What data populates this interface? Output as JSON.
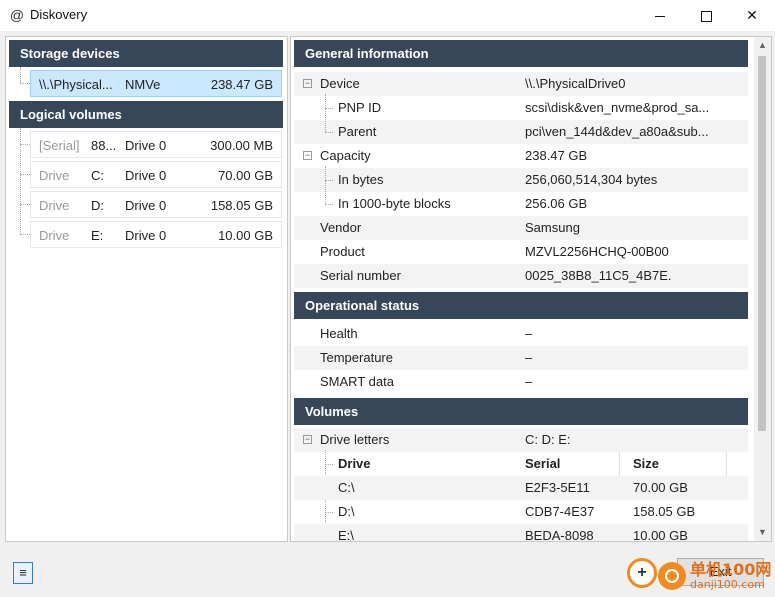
{
  "window": {
    "title": "Diskovery",
    "app_icon": "at-sign-icon"
  },
  "left": {
    "storage_header": "Storage devices",
    "storage_devices": [
      {
        "path": "\\\\.\\Physical...",
        "type": "NMVe",
        "size": "238.47 GB"
      }
    ],
    "volumes_header": "Logical volumes",
    "volumes": [
      {
        "label": "[Serial]",
        "letter": "88...",
        "drive": "Drive 0",
        "size": "300.00 MB"
      },
      {
        "label": "Drive",
        "letter": "C:",
        "drive": "Drive 0",
        "size": "70.00 GB"
      },
      {
        "label": "Drive",
        "letter": "D:",
        "drive": "Drive 0",
        "size": "158.05 GB"
      },
      {
        "label": "Drive",
        "letter": "E:",
        "drive": "Drive 0",
        "size": "10.00 GB"
      }
    ]
  },
  "right": {
    "general_header": "General information",
    "general": {
      "device_label": "Device",
      "device_value": "\\\\.\\PhysicalDrive0",
      "pnp_label": "PNP ID",
      "pnp_value": "scsi\\disk&ven_nvme&prod_sa...",
      "parent_label": "Parent",
      "parent_value": "pci\\ven_144d&dev_a80a&sub...",
      "capacity_label": "Capacity",
      "capacity_value": "238.47 GB",
      "bytes_label": "In bytes",
      "bytes_value": "256,060,514,304 bytes",
      "blocks_label": "In 1000-byte blocks",
      "blocks_value": "256.06 GB",
      "vendor_label": "Vendor",
      "vendor_value": "Samsung",
      "product_label": "Product",
      "product_value": "MZVL2256HCHQ-00B00",
      "serial_label": "Serial number",
      "serial_value": "0025_38B8_11C5_4B7E."
    },
    "status_header": "Operational status",
    "status": {
      "health_label": "Health",
      "health_value": "–",
      "temp_label": "Temperature",
      "temp_value": "–",
      "smart_label": "SMART data",
      "smart_value": "–"
    },
    "volumes_header": "Volumes",
    "drive_letters_label": "Drive letters",
    "drive_letters_value": "C:  D:  E:",
    "table_headers": {
      "drive": "Drive",
      "serial": "Serial",
      "size": "Size"
    },
    "table_rows": [
      {
        "drive": "C:\\",
        "serial": "E2F3-5E11",
        "size": "70.00 GB"
      },
      {
        "drive": "D:\\",
        "serial": "CDB7-4E37",
        "size": "158.05 GB"
      },
      {
        "drive": "E:\\",
        "serial": "BEDA-8098",
        "size": "10.00 GB"
      }
    ]
  },
  "bottom": {
    "menu_icon": "hamburger-menu-icon",
    "menu_glyph": "≡",
    "exit_label": "Exit",
    "watermark_line1": "单机100网",
    "watermark_line2": "danji100.com"
  },
  "colors": {
    "header_bg": "#37475a",
    "selected_bg": "#cce8ff",
    "accent": "#f28a1e"
  }
}
